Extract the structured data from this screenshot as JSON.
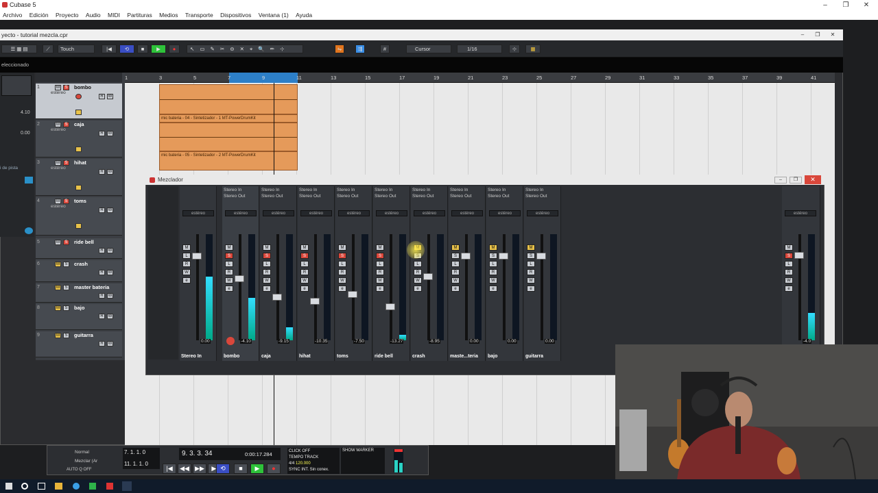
{
  "app": {
    "title": "Cubase 5",
    "accent": "#d9473b"
  },
  "menubar": [
    "Archivo",
    "Edición",
    "Proyecto",
    "Audio",
    "MIDI",
    "Partituras",
    "Medios",
    "Transporte",
    "Dispositivos",
    "Ventana (1)",
    "Ayuda"
  ],
  "project": {
    "title": "yecto - tutorial mezcla.cpr",
    "info_left": "eleccionado",
    "automation_mode": "Touch",
    "snap_mode": "Cursor",
    "quantize": "1/16",
    "left_values": [
      "4.10",
      "0.00"
    ],
    "left_label": "i de pista"
  },
  "ruler": {
    "marks": [
      "1",
      "3",
      "5",
      "7",
      "9",
      "11",
      "13",
      "15",
      "17",
      "19",
      "21",
      "23",
      "25",
      "27",
      "29",
      "31",
      "33",
      "35",
      "37",
      "39",
      "41"
    ]
  },
  "tracks": [
    {
      "num": "1",
      "name": "bombo",
      "sub": "estéreo"
    },
    {
      "num": "2",
      "name": "caja",
      "sub": "estéreo"
    },
    {
      "num": "3",
      "name": "hihat",
      "sub": "estéreo"
    },
    {
      "num": "4",
      "name": "toms",
      "sub": "estéreo"
    },
    {
      "num": "5",
      "name": "ride bell",
      "sub": ""
    },
    {
      "num": "6",
      "name": "crash",
      "sub": ""
    },
    {
      "num": "7",
      "name": "master bateria",
      "sub": ""
    },
    {
      "num": "8",
      "name": "bajo",
      "sub": ""
    },
    {
      "num": "9",
      "name": "guitarra",
      "sub": ""
    }
  ],
  "events": [
    {
      "label": ""
    },
    {
      "label": "mic bateria - 04 - Sintetizador - 1 MT-PowerDrumKit"
    },
    {
      "label": ""
    },
    {
      "label": "mic bateria - 05 - Sintetizador - 2 MT-PowerDrumKit"
    }
  ],
  "mixer": {
    "title": "Mezclador",
    "route_in": "Stereo In",
    "route_out": "Stereo Out",
    "pan_label": "estéreo",
    "channels": [
      {
        "name": "Stereo In",
        "value": "0.00",
        "level": 0.82,
        "meter": 0.6
      },
      {
        "name": "bombo",
        "value": "-4.10",
        "level": 0.6,
        "meter": 0.4
      },
      {
        "name": "caja",
        "value": "-9.15",
        "level": 0.42,
        "meter": 0.12
      },
      {
        "name": "hihat",
        "value": "-10.35",
        "level": 0.38,
        "meter": 0.0
      },
      {
        "name": "toms",
        "value": "-7.50",
        "level": 0.45,
        "meter": 0.0
      },
      {
        "name": "ride bell",
        "value": "-13.27",
        "level": 0.33,
        "meter": 0.05
      },
      {
        "name": "crash",
        "value": "-8.95",
        "level": 0.62,
        "meter": 0.0
      },
      {
        "name": "maste...teria",
        "value": "0.00",
        "level": 0.82,
        "meter": 0.0
      },
      {
        "name": "bajo",
        "value": "0.00",
        "level": 0.82,
        "meter": 0.0
      },
      {
        "name": "guitarra",
        "value": "0.00",
        "level": 0.82,
        "meter": 0.0
      }
    ],
    "master_value": "-4.0"
  },
  "transport": {
    "mode1": "Normal",
    "mode2": "Mezclar (Ar",
    "auto": "AUTO Q OFF",
    "left_loc": "7. 1. 1. 0",
    "right_loc": "11. 1. 1. 0",
    "position_bars": "9. 3. 3. 34",
    "position_time": "0:00:17.284",
    "click": "CLICK OFF",
    "tempo": "TEMPO TRACK",
    "signature": "4/4",
    "bpm": "120.000",
    "sync": "SYNC INT. Sin conex.",
    "show": "SHOW",
    "marker": "MARKER"
  }
}
